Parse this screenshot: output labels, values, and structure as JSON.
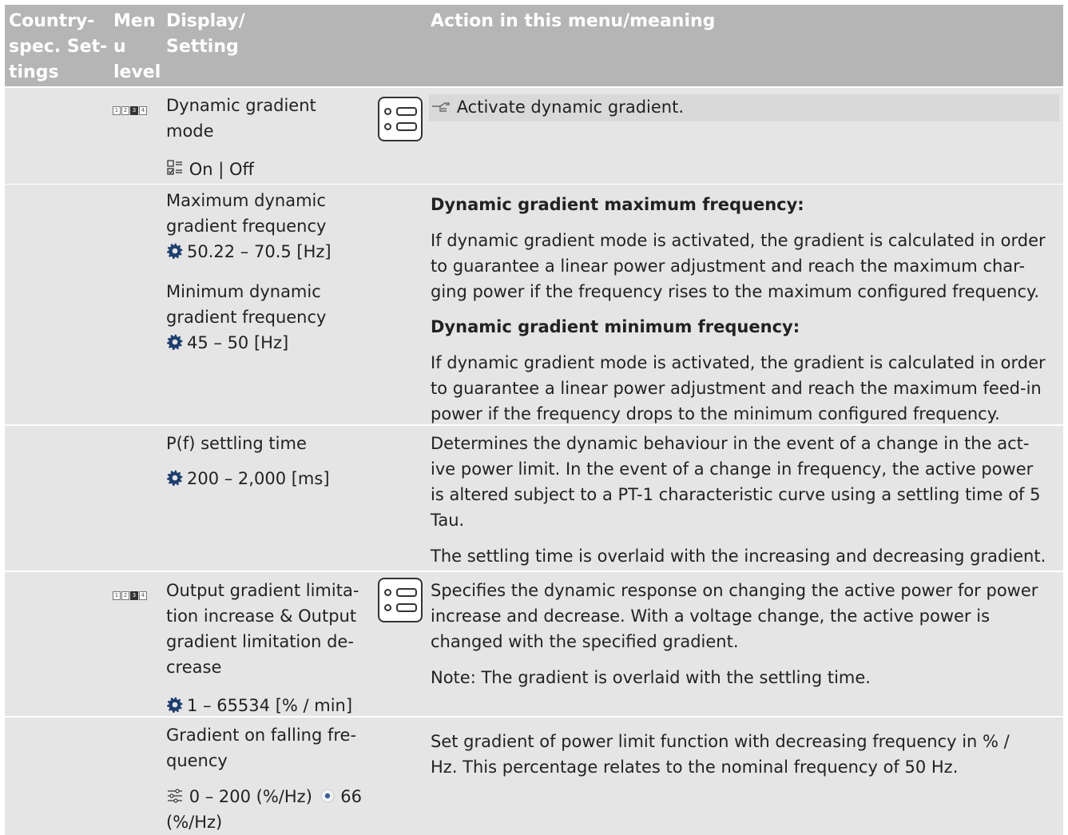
{
  "header": {
    "col1": [
      "Country-",
      "spec. Set-",
      "tings"
    ],
    "col2": [
      "Men",
      "u",
      "level"
    ],
    "col3": [
      "Display/",
      "Setting"
    ],
    "col4": "Action in this menu/meaning"
  },
  "rows": {
    "r1": {
      "levels": [
        "1",
        "2",
        "3",
        "4"
      ],
      "setting": [
        "Dynamic gradient",
        "mode"
      ],
      "values": "On | Off",
      "action": "Activate dynamic gradient."
    },
    "r2": {
      "setting_a": [
        "Maximum dynamic",
        "gradient frequency"
      ],
      "range_a": "50.22 – 70.5 [Hz]",
      "setting_b": [
        "Minimum dynamic",
        "gradient frequency"
      ],
      "range_b": "45 – 50 [Hz]",
      "head_a": "Dynamic gradient maximum frequency:",
      "text_a": [
        "If dynamic gradient mode is activated, the gradient is calculated in order",
        "to guarantee a linear power adjustment and reach the maximum char-",
        "ging power if the frequency rises to the maximum configured frequency."
      ],
      "head_b": "Dynamic gradient minimum frequency:",
      "text_b": [
        "If dynamic gradient mode is activated, the gradient is calculated in order",
        "to guarantee a linear power adjustment and reach the maximum feed-in",
        "power if the frequency drops to the minimum configured frequency."
      ]
    },
    "r3": {
      "setting": "P(f) settling time",
      "range": "200 – 2,000 [ms]",
      "text_a": [
        "Determines the dynamic behaviour in the event of a change in the act-",
        "ive power limit. In the event of a change in frequency, the active power",
        "is altered subject to a PT-1 characteristic curve using a settling time of 5",
        "Tau."
      ],
      "text_b": "The settling time is overlaid with the increasing and decreasing gradient."
    },
    "r4": {
      "levels": [
        "1",
        "2",
        "3",
        "4"
      ],
      "setting": [
        "Output gradient limita-",
        "tion increase & Output",
        "gradient limitation de-",
        "crease"
      ],
      "range": "1 – 65534 [% / min]",
      "text_a": [
        "Specifies the dynamic response on changing the active power for power",
        "increase and decrease. With a voltage change, the active power is",
        "changed with the specified gradient."
      ],
      "text_b": "Note: The gradient is overlaid with the settling time."
    },
    "r5": {
      "setting": [
        "Gradient on falling fre-",
        "quency"
      ],
      "range": "0 – 200 (%/Hz)",
      "default": "66",
      "range_cont": "(%/Hz)",
      "text": [
        "Set gradient of power limit function with decreasing frequency in % /",
        "Hz. This percentage relates to the nominal frequency of 50 Hz."
      ]
    }
  }
}
